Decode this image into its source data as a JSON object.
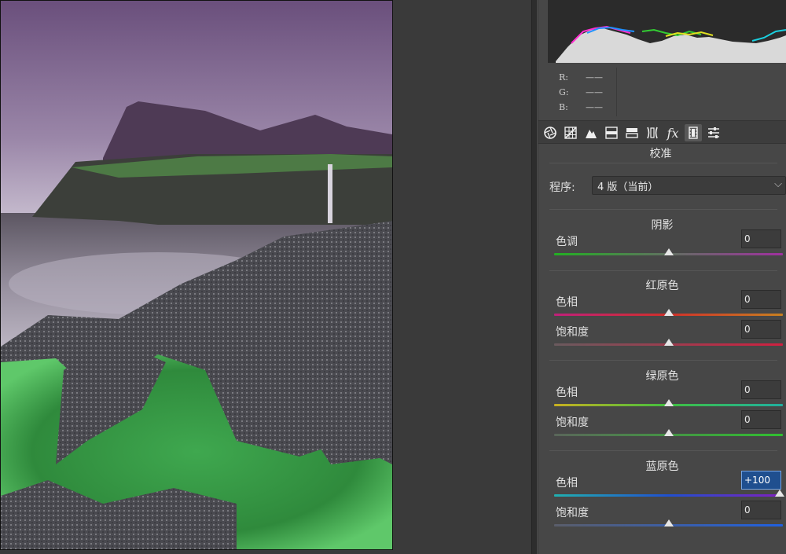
{
  "panel": {
    "rgb": [
      {
        "label": "R:",
        "value": "——"
      },
      {
        "label": "G:",
        "value": "——"
      },
      {
        "label": "B:",
        "value": "——"
      }
    ],
    "tools": [
      "basic-aperture-icon",
      "tone-curve-grid-icon",
      "detail-triangle-icon",
      "hsl-icon",
      "split-toning-icon",
      "lens-correction-icon",
      "effects-fx-icon",
      "calibration-film-icon",
      "presets-sliders-icon"
    ],
    "active_tool": "calibration-film-icon",
    "title": "校准",
    "program": {
      "label": "程序:",
      "value": "4 版（当前）"
    },
    "shadows": {
      "title": "阴影",
      "tint": {
        "label": "色调",
        "value": "0",
        "level": 0.5
      }
    },
    "red_primary": {
      "title": "红原色",
      "hue": {
        "label": "色相",
        "value": "0",
        "level": 0.5
      },
      "saturation": {
        "label": "饱和度",
        "value": "0",
        "level": 0.5
      }
    },
    "green_primary": {
      "title": "绿原色",
      "hue": {
        "label": "色相",
        "value": "0",
        "level": 0.5
      },
      "saturation": {
        "label": "饱和度",
        "value": "0",
        "level": 0.5
      }
    },
    "blue_primary": {
      "title": "蓝原色",
      "hue": {
        "label": "色相",
        "value": "+100",
        "level": 1.0
      },
      "saturation": {
        "label": "饱和度",
        "value": "0",
        "level": 0.5
      }
    }
  }
}
